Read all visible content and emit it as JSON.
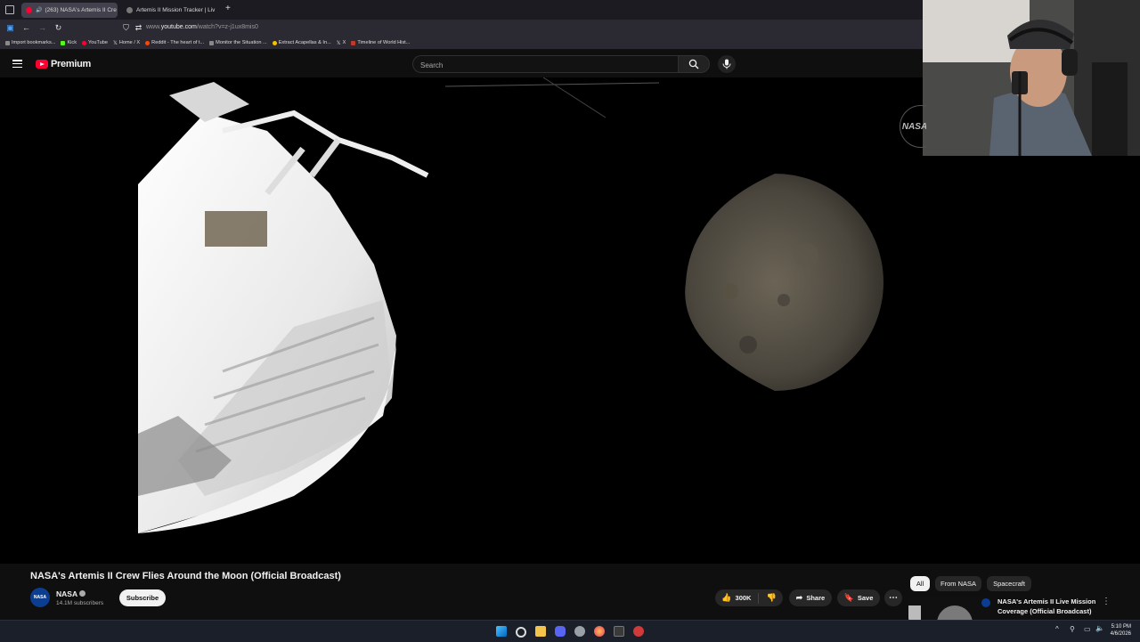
{
  "browser": {
    "tabs": [
      {
        "label": "(263) NASA's Artemis II Cre",
        "active": true
      },
      {
        "label": "Artemis II Mission Tracker | Liv",
        "active": false
      }
    ],
    "url_prefix": "www.",
    "url_host": "youtube.com",
    "url_path": "/watch?v=z-j1ux8mis0",
    "bookmarks": [
      {
        "label": "Import bookmarks...",
        "color": "#8a8a8a"
      },
      {
        "label": "Kick",
        "color": "#53fc18"
      },
      {
        "label": "YouTube",
        "color": "#ff0033"
      },
      {
        "label": "Home / X",
        "color": "#ffffff"
      },
      {
        "label": "Reddit - The heart of t...",
        "color": "#ff4500"
      },
      {
        "label": "Monitor the Situation ...",
        "color": "#888888"
      },
      {
        "label": "Extract Acapellas & In...",
        "color": "#f5c400"
      },
      {
        "label": "X",
        "color": "#ffffff"
      },
      {
        "label": "Timeline of World Hist...",
        "color": "#c0392b"
      }
    ]
  },
  "youtube": {
    "logo_text": "Premium",
    "search_placeholder": "Search"
  },
  "overlay": {
    "nasa_text": "NASA"
  },
  "video": {
    "title": "NASA's Artemis II Crew Flies Around the Moon (Official Broadcast)",
    "channel": "NASA",
    "avatar_text": "NASA",
    "subscribers": "14.1M subscribers",
    "subscribe_label": "Subscribe",
    "likes": "300K",
    "share_label": "Share",
    "save_label": "Save"
  },
  "sidebar": {
    "chips": [
      {
        "label": "All",
        "selected": true
      },
      {
        "label": "From NASA",
        "selected": false
      },
      {
        "label": "Spacecraft",
        "selected": false
      }
    ],
    "recommendation": {
      "title": "NASA's Artemis II Live Mission Coverage (Official Broadcast)"
    }
  },
  "taskbar": {
    "time": "5:10 PM",
    "date": "4/6/2026"
  }
}
